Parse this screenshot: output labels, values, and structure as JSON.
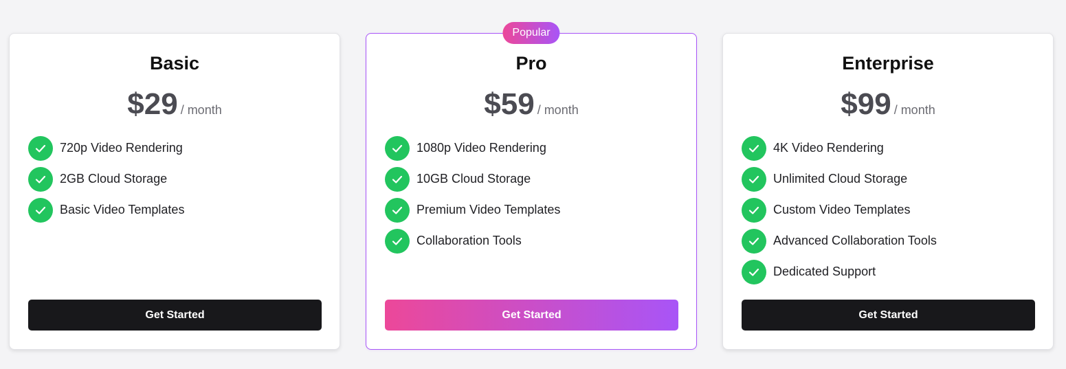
{
  "plans": [
    {
      "name": "Basic",
      "price": "$29",
      "period": "/ month",
      "features": [
        "720p Video Rendering",
        "2GB Cloud Storage",
        "Basic Video Templates"
      ],
      "cta": "Get Started"
    },
    {
      "name": "Pro",
      "badge": "Popular",
      "price": "$59",
      "period": "/ month",
      "features": [
        "1080p Video Rendering",
        "10GB Cloud Storage",
        "Premium Video Templates",
        "Collaboration Tools"
      ],
      "cta": "Get Started"
    },
    {
      "name": "Enterprise",
      "price": "$99",
      "period": "/ month",
      "features": [
        "4K Video Rendering",
        "Unlimited Cloud Storage",
        "Custom Video Templates",
        "Advanced Collaboration Tools",
        "Dedicated Support"
      ],
      "cta": "Get Started"
    }
  ],
  "colors": {
    "accent_start": "#ec4899",
    "accent_end": "#a855f7",
    "check": "#22c55e",
    "button_dark": "#18181b"
  },
  "icons": {
    "feature": "check-icon"
  }
}
